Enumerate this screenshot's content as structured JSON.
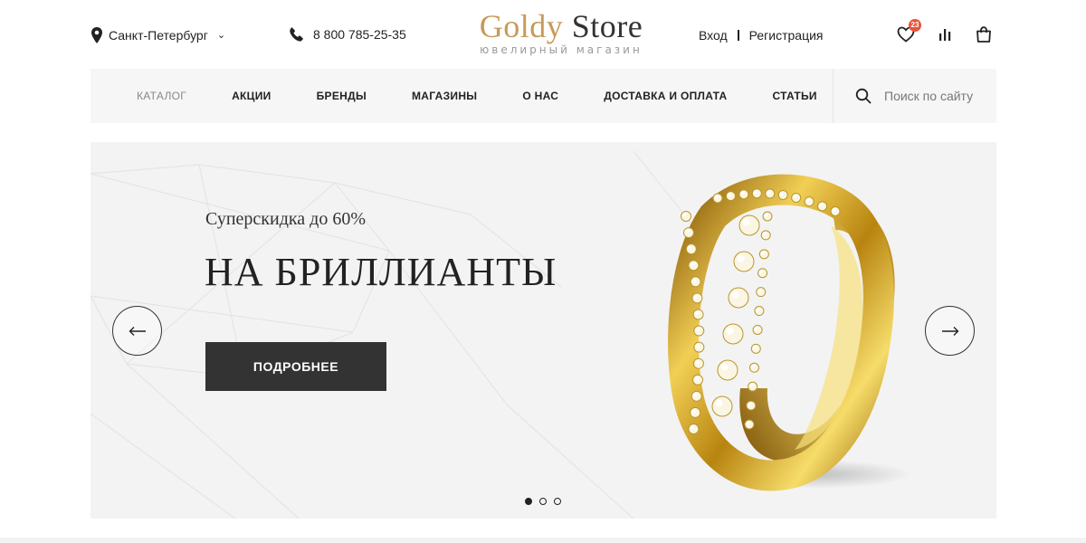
{
  "header": {
    "city": "Санкт-Петербург",
    "phone": "8 800 785-25-35",
    "logo": {
      "part1": "Goldy",
      "part2": "Store",
      "subtitle": "ювелирный магазин"
    },
    "login": "Вход",
    "register": "Регистрация",
    "wishlist_count": "23",
    "icons": [
      "location-pin-icon",
      "phone-icon",
      "heart-icon",
      "chart-icon",
      "shopping-bag-icon"
    ]
  },
  "nav": {
    "items": [
      {
        "label": "КАТАЛОГ"
      },
      {
        "label": "АКЦИИ"
      },
      {
        "label": "БРЕНДЫ"
      },
      {
        "label": "МАГАЗИНЫ"
      },
      {
        "label": "О НАС"
      },
      {
        "label": "ДОСТАВКА И ОПЛАТА"
      },
      {
        "label": "СТАТЬИ"
      }
    ],
    "search_placeholder": "Поиск по сайту"
  },
  "slider": {
    "subtitle": "Суперскидка до 60%",
    "title": "НА БРИЛЛИАНТЫ",
    "button": "ПОДРОБНЕЕ",
    "prev_arrow": "←",
    "next_arrow": "→",
    "slide_count": 3,
    "active_slide": 1
  },
  "colors": {
    "logo_gold": "#c79a5a",
    "button_bg": "#333333",
    "badge": "#e8553c",
    "nav_bg": "#f6f6f6",
    "hero_bg": "#f3f3f3"
  }
}
